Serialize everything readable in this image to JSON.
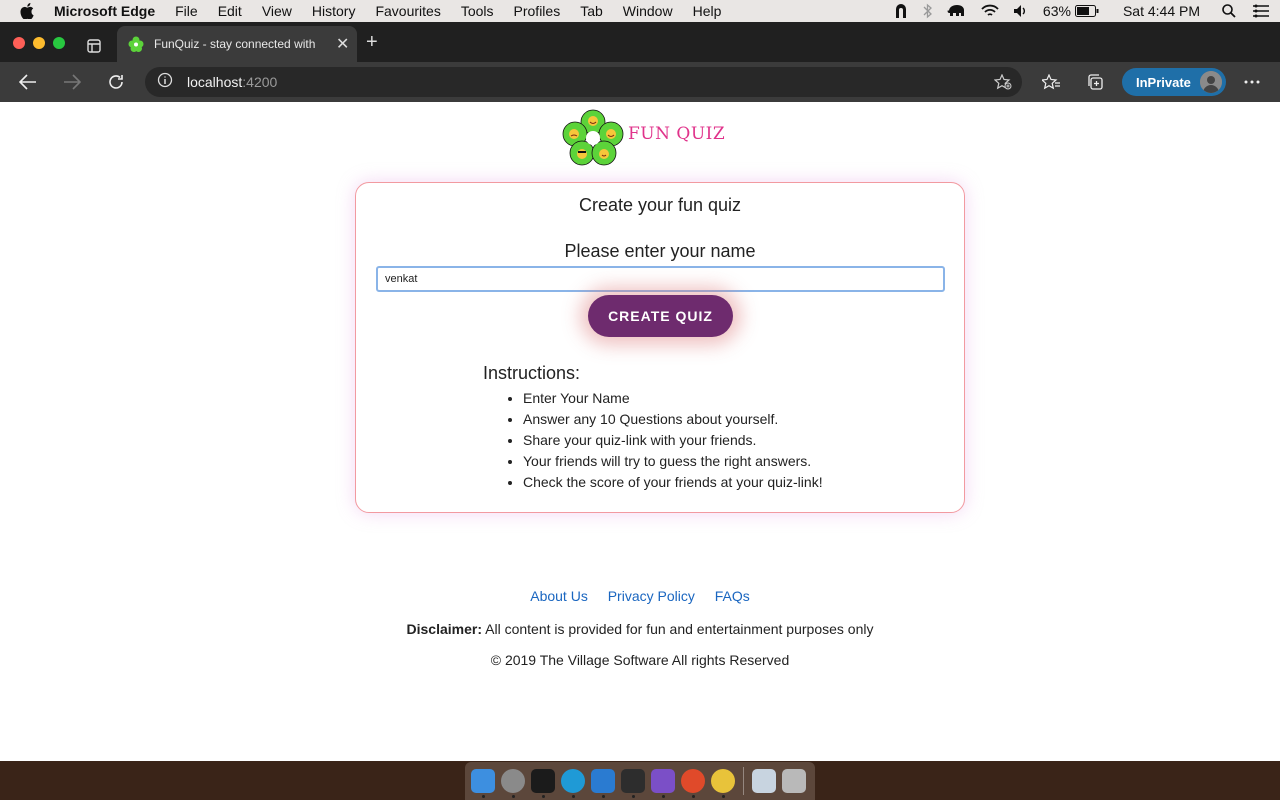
{
  "menubar": {
    "app_name": "Microsoft Edge",
    "items": [
      "File",
      "Edit",
      "View",
      "History",
      "Favourites",
      "Tools",
      "Profiles",
      "Tab",
      "Window",
      "Help"
    ],
    "battery": "63%",
    "clock": "Sat 4:44 PM"
  },
  "browser": {
    "tab_title": "FunQuiz - stay connected with",
    "url_host": "localhost",
    "url_port": ":4200",
    "inprivate_label": "InPrivate"
  },
  "logo": {
    "text": "FUN QUIZ"
  },
  "card": {
    "title": "Create your fun quiz",
    "name_label": "Please enter your name",
    "name_value": "venkat",
    "button_label": "CREATE QUIZ",
    "instructions_title": "Instructions:",
    "instructions": [
      "Enter Your Name",
      "Answer any 10 Questions about yourself.",
      "Share your quiz-link with your friends.",
      "Your friends will try to guess the right answers.",
      "Check the score of your friends at your quiz-link!"
    ]
  },
  "footer": {
    "links": [
      "About Us",
      "Privacy Policy",
      "FAQs"
    ],
    "disclaimer_label": "Disclaimer:",
    "disclaimer_text": " All content is provided for fun and entertainment purposes only",
    "copyright": "© 2019 The Village Software All rights Reserved"
  },
  "colors": {
    "brand_pink": "#e0338b",
    "button_purple": "#6e2b6e",
    "link_blue": "#1a66c0",
    "card_border": "#f29aa0"
  },
  "dock_icons": [
    "finder-icon",
    "launchpad-icon",
    "terminal-icon",
    "edge-icon",
    "vscode-icon",
    "app-icon",
    "visual-studio-icon",
    "remote-desktop-icon",
    "chrome-icon",
    "preview-icon",
    "trash-icon"
  ]
}
